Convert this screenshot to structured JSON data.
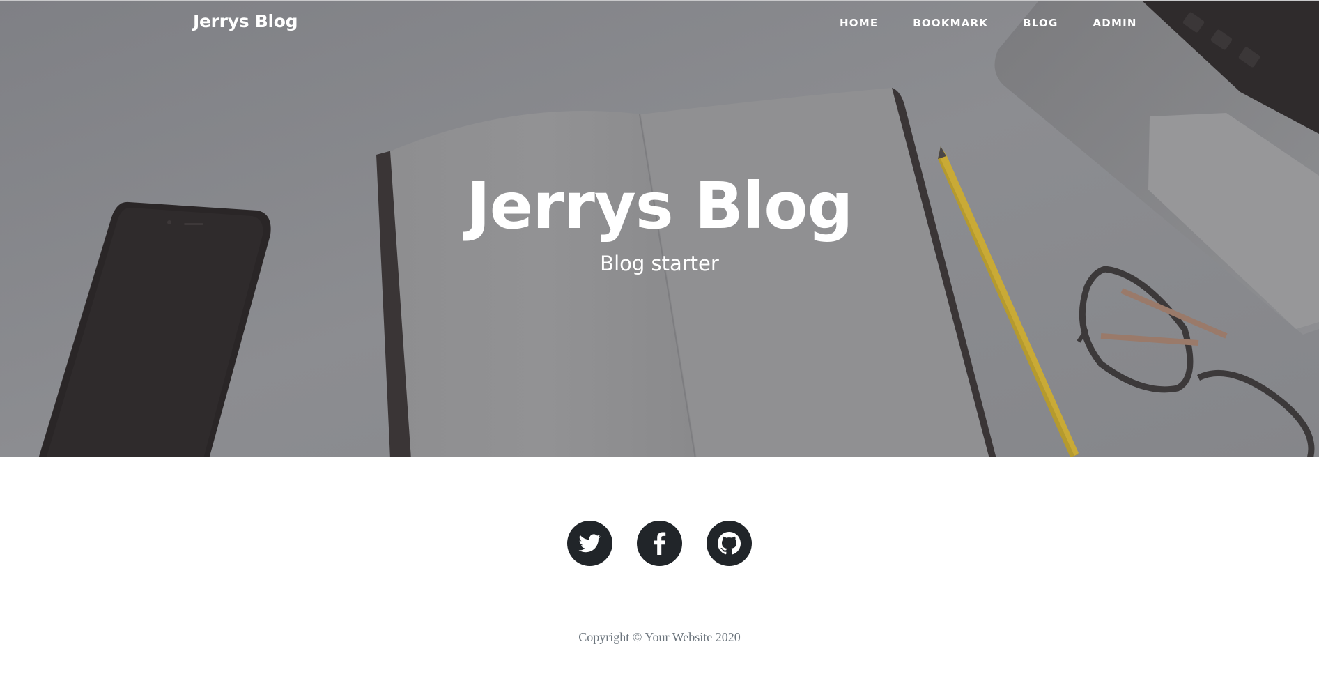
{
  "navbar": {
    "brand": "Jerrys Blog",
    "links": [
      {
        "label": "HOME"
      },
      {
        "label": "BOOKMARK"
      },
      {
        "label": "BLOG"
      },
      {
        "label": "ADMIN"
      }
    ]
  },
  "hero": {
    "title": "Jerrys Blog",
    "subtitle": "Blog starter",
    "background": "desk-with-phone-notebook-pencil-glasses-laptop"
  },
  "footer": {
    "social": [
      {
        "icon": "twitter-icon"
      },
      {
        "icon": "facebook-icon"
      },
      {
        "icon": "github-icon"
      }
    ],
    "copyright": "Copyright © Your Website 2020"
  },
  "colors": {
    "overlay": "#86878b",
    "social_bg": "#212529",
    "copyright_text": "#6c757d"
  }
}
